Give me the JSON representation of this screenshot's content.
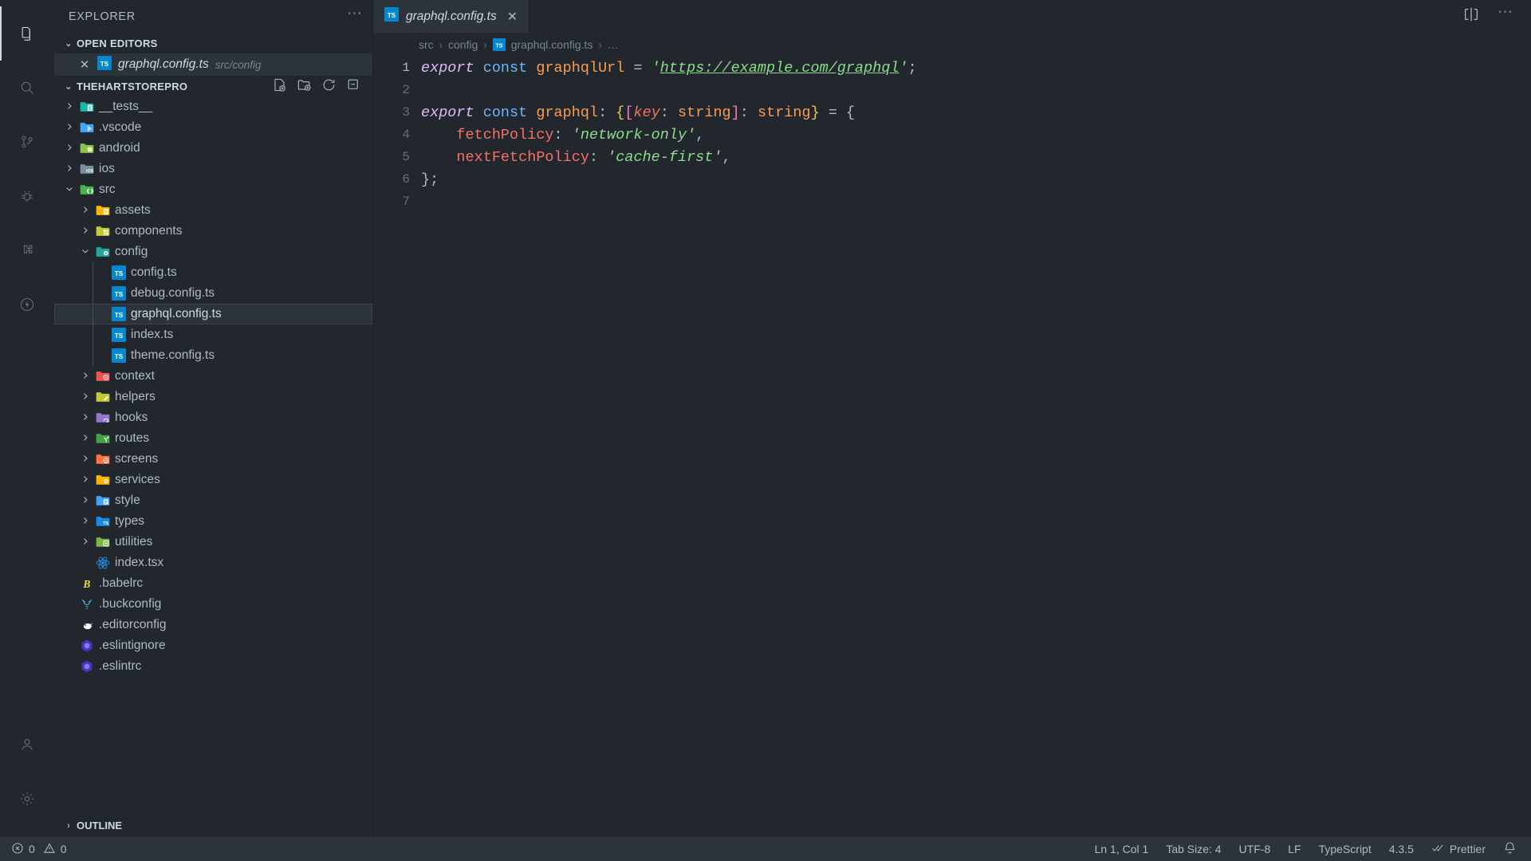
{
  "activitybar": {
    "items": [
      {
        "name": "explorer-icon",
        "title": "Explorer",
        "active": true
      },
      {
        "name": "search-icon",
        "title": "Search",
        "active": false
      },
      {
        "name": "source-control-icon",
        "title": "Source Control",
        "active": false
      },
      {
        "name": "debug-icon",
        "title": "Run and Debug",
        "active": false
      },
      {
        "name": "extensions-icon",
        "title": "Extensions",
        "active": false
      },
      {
        "name": "lightning-icon",
        "title": "Thunder Client",
        "active": false
      }
    ],
    "bottom": [
      {
        "name": "account-icon",
        "title": "Accounts"
      },
      {
        "name": "gear-icon",
        "title": "Manage"
      }
    ]
  },
  "sidebar": {
    "title": "EXPLORER",
    "more_label": "⋯",
    "open_editors": {
      "label": "OPEN EDITORS",
      "caret": "⌄",
      "items": [
        {
          "close": "✕",
          "name": "graphql.config.ts",
          "path": "src/config",
          "icon": "ts-file-icon"
        }
      ]
    },
    "project": {
      "label": "THEHARTSTOREPRO",
      "caret": "⌄",
      "actions": [
        "new-file-icon",
        "new-folder-icon",
        "refresh-icon",
        "collapse-all-icon"
      ]
    },
    "tree": [
      {
        "label": "__tests__",
        "type": "folder",
        "icon": "folder-tests",
        "depth": 1,
        "expanded": false
      },
      {
        "label": ".vscode",
        "type": "folder",
        "icon": "folder-vscode",
        "depth": 1,
        "expanded": false
      },
      {
        "label": "android",
        "type": "folder",
        "icon": "folder-android",
        "depth": 1,
        "expanded": false
      },
      {
        "label": "ios",
        "type": "folder",
        "icon": "folder-ios",
        "depth": 1,
        "expanded": false
      },
      {
        "label": "src",
        "type": "folder",
        "icon": "folder-src",
        "depth": 1,
        "expanded": true
      },
      {
        "label": "assets",
        "type": "folder",
        "icon": "folder-assets",
        "depth": 2,
        "expanded": false
      },
      {
        "label": "components",
        "type": "folder",
        "icon": "folder-components",
        "depth": 2,
        "expanded": false
      },
      {
        "label": "config",
        "type": "folder",
        "icon": "folder-config",
        "depth": 2,
        "expanded": true
      },
      {
        "label": "config.ts",
        "type": "file",
        "icon": "ts-file-icon",
        "depth": 3
      },
      {
        "label": "debug.config.ts",
        "type": "file",
        "icon": "ts-file-icon",
        "depth": 3
      },
      {
        "label": "graphql.config.ts",
        "type": "file",
        "icon": "ts-file-icon",
        "depth": 3,
        "selected": true
      },
      {
        "label": "index.ts",
        "type": "file",
        "icon": "ts-file-icon",
        "depth": 3
      },
      {
        "label": "theme.config.ts",
        "type": "file",
        "icon": "ts-file-icon",
        "depth": 3
      },
      {
        "label": "context",
        "type": "folder",
        "icon": "folder-context",
        "depth": 2,
        "expanded": false
      },
      {
        "label": "helpers",
        "type": "folder",
        "icon": "folder-helpers",
        "depth": 2,
        "expanded": false
      },
      {
        "label": "hooks",
        "type": "folder",
        "icon": "folder-hooks",
        "depth": 2,
        "expanded": false
      },
      {
        "label": "routes",
        "type": "folder",
        "icon": "folder-routes",
        "depth": 2,
        "expanded": false
      },
      {
        "label": "screens",
        "type": "folder",
        "icon": "folder-screens",
        "depth": 2,
        "expanded": false
      },
      {
        "label": "services",
        "type": "folder",
        "icon": "folder-services",
        "depth": 2,
        "expanded": false
      },
      {
        "label": "style",
        "type": "folder",
        "icon": "folder-style",
        "depth": 2,
        "expanded": false
      },
      {
        "label": "types",
        "type": "folder",
        "icon": "folder-types",
        "depth": 2,
        "expanded": false
      },
      {
        "label": "utilities",
        "type": "folder",
        "icon": "folder-utilities",
        "depth": 2,
        "expanded": false
      },
      {
        "label": "index.tsx",
        "type": "file",
        "icon": "react-icon",
        "depth": 2
      },
      {
        "label": ".babelrc",
        "type": "file",
        "icon": "babel-icon",
        "depth": 1
      },
      {
        "label": ".buckconfig",
        "type": "file",
        "icon": "buck-icon",
        "depth": 1
      },
      {
        "label": ".editorconfig",
        "type": "file",
        "icon": "editorconfig-icon",
        "depth": 1
      },
      {
        "label": ".eslintignore",
        "type": "file",
        "icon": "eslint-icon",
        "depth": 1
      },
      {
        "label": ".eslintrc",
        "type": "file",
        "icon": "eslint-icon",
        "depth": 1
      }
    ],
    "outline": {
      "label": "OUTLINE",
      "caret": "›"
    }
  },
  "editor": {
    "tabs": [
      {
        "label": "graphql.config.ts",
        "icon": "ts-file-icon",
        "close": "✕",
        "active": true,
        "preview": true
      }
    ],
    "actions": [
      "split-editor-icon",
      "more-actions-icon"
    ],
    "breadcrumb": [
      {
        "label": "src",
        "icon": null
      },
      {
        "label": "config",
        "icon": null
      },
      {
        "label": "graphql.config.ts",
        "icon": "ts-file-icon"
      },
      {
        "label": "…",
        "icon": null
      }
    ],
    "breadcrumb_separator": "›",
    "lines": [
      {
        "num": "1",
        "current": true
      },
      {
        "num": "2",
        "current": false
      },
      {
        "num": "3",
        "current": false
      },
      {
        "num": "4",
        "current": false
      },
      {
        "num": "5",
        "current": false
      },
      {
        "num": "6",
        "current": false
      },
      {
        "num": "7",
        "current": false
      }
    ],
    "code": {
      "l1_export": "export",
      "l1_const": " const",
      "l1_ident": " graphqlUrl",
      "l1_eq": " = ",
      "l1_q1": "'",
      "l1_url": "https://example.com/graphql",
      "l1_q2": "'",
      "l1_semi": ";",
      "l3_export": "export",
      "l3_const": " const",
      "l3_ident": " graphql",
      "l3_colon": ": ",
      "l3_b1": "{",
      "l3_b2": "[",
      "l3_key": "key",
      "l3_c2": ": ",
      "l3_string1": "string",
      "l3_b3": "]",
      "l3_c3": ": ",
      "l3_string2": "string",
      "l3_b4": "}",
      "l3_eq": " = ",
      "l3_b5": "{",
      "l4_prop": "    fetchPolicy",
      "l4_colon": ": ",
      "l4_val": "'network-only'",
      "l4_comma": ",",
      "l5_prop": "    nextFetchPolicy",
      "l5_colon": ": ",
      "l5_val": "'cache-first'",
      "l5_comma": ",",
      "l6_close": "};"
    }
  },
  "statusbar": {
    "errors_icon": "error-circle-icon",
    "errors": "0",
    "warnings_icon": "warning-triangle-icon",
    "warnings": "0",
    "right": [
      {
        "name": "cursor-position",
        "label": "Ln 1, Col 1"
      },
      {
        "name": "tab-size",
        "label": "Tab Size: 4"
      },
      {
        "name": "encoding",
        "label": "UTF-8"
      },
      {
        "name": "eol",
        "label": "LF"
      },
      {
        "name": "language-mode",
        "label": "TypeScript"
      },
      {
        "name": "typescript-version",
        "label": "4.3.5"
      },
      {
        "name": "prettier-status",
        "label": "Prettier",
        "icon": "check-check-icon"
      },
      {
        "name": "notifications",
        "label": "",
        "icon": "bell-icon"
      }
    ]
  },
  "colors": {
    "background": "#22272e",
    "sidebar_selected": "#2d333b",
    "statusbar": "#2d333b",
    "accent_blue": "#0288d1",
    "string_green": "#8ddb8c",
    "keyword_red": "#f47067",
    "export_purple": "#dcbdfb",
    "const_blue": "#6cb6ff",
    "ident_orange": "#f69d50"
  }
}
